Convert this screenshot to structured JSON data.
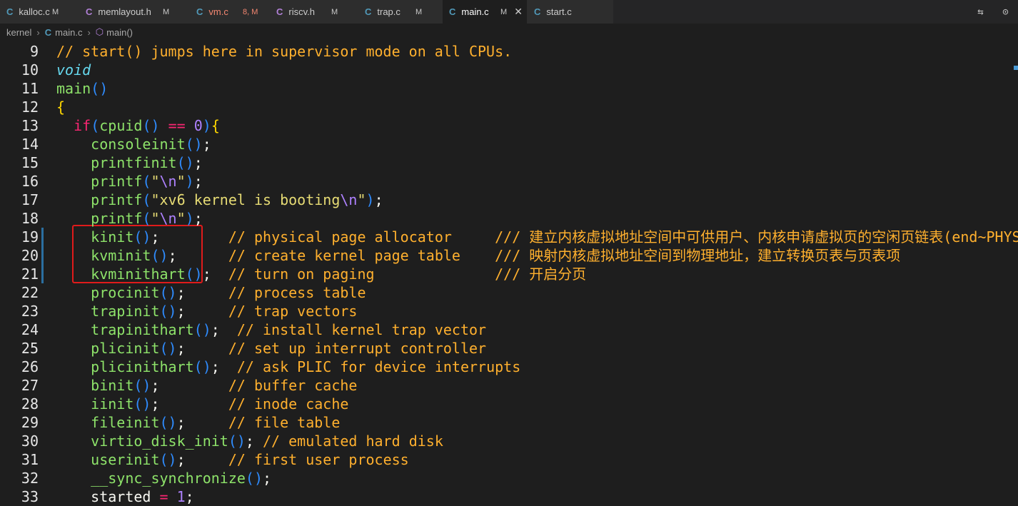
{
  "tabs": [
    {
      "icon": "C",
      "icon_color": "#519aba",
      "name": "kalloc.c",
      "status": "M",
      "status_color": "#c8c8c8",
      "name_color": "#cccccc"
    },
    {
      "icon": "C",
      "icon_color": "#b180d7",
      "name": "memlayout.h",
      "status": "M",
      "status_color": "#c8c8c8",
      "name_color": "#cccccc"
    },
    {
      "icon": "C",
      "icon_color": "#519aba",
      "name": "vm.c",
      "status": "8, M",
      "status_color": "#f48771",
      "name_color": "#f48771"
    },
    {
      "icon": "C",
      "icon_color": "#b180d7",
      "name": "riscv.h",
      "status": "M",
      "status_color": "#c8c8c8",
      "name_color": "#cccccc"
    },
    {
      "icon": "C",
      "icon_color": "#519aba",
      "name": "trap.c",
      "status": "M",
      "status_color": "#c8c8c8",
      "name_color": "#cccccc"
    },
    {
      "icon": "C",
      "icon_color": "#519aba",
      "name": "main.c",
      "status": "M",
      "status_color": "#c8c8c8",
      "name_color": "#ffffff",
      "active": true
    },
    {
      "icon": "C",
      "icon_color": "#519aba",
      "name": "start.c",
      "status": "",
      "status_color": "#c8c8c8",
      "name_color": "#cccccc"
    }
  ],
  "tab_close_glyph": "✕",
  "breadcrumb": {
    "folder": "kernel",
    "file": "main.c",
    "symbol": "main()"
  },
  "gutter": {
    "line_numbers": [
      "9",
      "10",
      "11",
      "12",
      "13",
      "14",
      "15",
      "16",
      "17",
      "18",
      "19",
      "20",
      "21",
      "22",
      "23",
      "24",
      "25",
      "26",
      "27",
      "28",
      "29",
      "30",
      "31",
      "32",
      "33"
    ]
  },
  "code_lines": [
    [
      [
        "cmt",
        "// start() jumps here in supervisor mode on all CPUs."
      ]
    ],
    [
      [
        "kw-type",
        "void"
      ]
    ],
    [
      [
        "fn",
        "main"
      ],
      [
        "paren",
        "()"
      ]
    ],
    [
      [
        "brace",
        "{"
      ]
    ],
    [
      [
        "plain",
        "  "
      ],
      [
        "kw",
        "if"
      ],
      [
        "paren",
        "("
      ],
      [
        "fn",
        "cpuid"
      ],
      [
        "paren",
        "()"
      ],
      [
        "plain",
        " "
      ],
      [
        "kw",
        "=="
      ],
      [
        "plain",
        " "
      ],
      [
        "num",
        "0"
      ],
      [
        "paren",
        ")"
      ],
      [
        "brace",
        "{"
      ]
    ],
    [
      [
        "plain",
        "    "
      ],
      [
        "fn",
        "consoleinit"
      ],
      [
        "paren",
        "()"
      ],
      [
        "plain",
        ";"
      ]
    ],
    [
      [
        "plain",
        "    "
      ],
      [
        "fn",
        "printfinit"
      ],
      [
        "paren",
        "()"
      ],
      [
        "plain",
        ";"
      ]
    ],
    [
      [
        "plain",
        "    "
      ],
      [
        "fn",
        "printf"
      ],
      [
        "paren",
        "("
      ],
      [
        "str",
        "\""
      ],
      [
        "esc",
        "\\n"
      ],
      [
        "str",
        "\""
      ],
      [
        "paren",
        ")"
      ],
      [
        "plain",
        ";"
      ]
    ],
    [
      [
        "plain",
        "    "
      ],
      [
        "fn",
        "printf"
      ],
      [
        "paren",
        "("
      ],
      [
        "str",
        "\"xv6 kernel is booting"
      ],
      [
        "esc",
        "\\n"
      ],
      [
        "str",
        "\""
      ],
      [
        "paren",
        ")"
      ],
      [
        "plain",
        ";"
      ]
    ],
    [
      [
        "plain",
        "    "
      ],
      [
        "fn",
        "printf"
      ],
      [
        "paren",
        "("
      ],
      [
        "str",
        "\""
      ],
      [
        "esc",
        "\\n"
      ],
      [
        "str",
        "\""
      ],
      [
        "paren",
        ")"
      ],
      [
        "plain",
        ";"
      ]
    ],
    [
      [
        "plain",
        "    "
      ],
      [
        "fn",
        "kinit"
      ],
      [
        "paren",
        "()"
      ],
      [
        "plain",
        ";        "
      ],
      [
        "cmt",
        "// physical page allocator     /// 建立内核虚拟地址空间中可供用户、内核申请虚拟页的空闲页链表(end~PHYSTOP)"
      ]
    ],
    [
      [
        "plain",
        "    "
      ],
      [
        "fn",
        "kvminit"
      ],
      [
        "paren",
        "()"
      ],
      [
        "plain",
        ";      "
      ],
      [
        "cmt",
        "// create kernel page table    /// 映射内核虚拟地址空间到物理地址，建立转换页表与页表项"
      ]
    ],
    [
      [
        "plain",
        "    "
      ],
      [
        "fn",
        "kvminithart"
      ],
      [
        "paren",
        "()"
      ],
      [
        "plain",
        ";  "
      ],
      [
        "cmt",
        "// turn on paging              /// 开启分页"
      ]
    ],
    [
      [
        "plain",
        "    "
      ],
      [
        "fn",
        "procinit"
      ],
      [
        "paren",
        "()"
      ],
      [
        "plain",
        ";     "
      ],
      [
        "cmt",
        "// process table"
      ]
    ],
    [
      [
        "plain",
        "    "
      ],
      [
        "fn",
        "trapinit"
      ],
      [
        "paren",
        "()"
      ],
      [
        "plain",
        ";     "
      ],
      [
        "cmt",
        "// trap vectors"
      ]
    ],
    [
      [
        "plain",
        "    "
      ],
      [
        "fn",
        "trapinithart"
      ],
      [
        "paren",
        "()"
      ],
      [
        "plain",
        ";  "
      ],
      [
        "cmt",
        "// install kernel trap vector"
      ]
    ],
    [
      [
        "plain",
        "    "
      ],
      [
        "fn",
        "plicinit"
      ],
      [
        "paren",
        "()"
      ],
      [
        "plain",
        ";     "
      ],
      [
        "cmt",
        "// set up interrupt controller"
      ]
    ],
    [
      [
        "plain",
        "    "
      ],
      [
        "fn",
        "plicinithart"
      ],
      [
        "paren",
        "()"
      ],
      [
        "plain",
        ";  "
      ],
      [
        "cmt",
        "// ask PLIC for device interrupts"
      ]
    ],
    [
      [
        "plain",
        "    "
      ],
      [
        "fn",
        "binit"
      ],
      [
        "paren",
        "()"
      ],
      [
        "plain",
        ";        "
      ],
      [
        "cmt",
        "// buffer cache"
      ]
    ],
    [
      [
        "plain",
        "    "
      ],
      [
        "fn",
        "iinit"
      ],
      [
        "paren",
        "()"
      ],
      [
        "plain",
        ";        "
      ],
      [
        "cmt",
        "// inode cache"
      ]
    ],
    [
      [
        "plain",
        "    "
      ],
      [
        "fn",
        "fileinit"
      ],
      [
        "paren",
        "()"
      ],
      [
        "plain",
        ";     "
      ],
      [
        "cmt",
        "// file table"
      ]
    ],
    [
      [
        "plain",
        "    "
      ],
      [
        "fn",
        "virtio_disk_init"
      ],
      [
        "paren",
        "()"
      ],
      [
        "plain",
        "; "
      ],
      [
        "cmt",
        "// emulated hard disk"
      ]
    ],
    [
      [
        "plain",
        "    "
      ],
      [
        "fn",
        "userinit"
      ],
      [
        "paren",
        "()"
      ],
      [
        "plain",
        ";     "
      ],
      [
        "cmt",
        "// first user process"
      ]
    ],
    [
      [
        "plain",
        "    "
      ],
      [
        "fn",
        "__sync_synchronize"
      ],
      [
        "paren",
        "()"
      ],
      [
        "plain",
        ";"
      ]
    ],
    [
      [
        "plain",
        "    started "
      ],
      [
        "kw",
        "="
      ],
      [
        "plain",
        " "
      ],
      [
        "num",
        "1"
      ],
      [
        "plain",
        ";"
      ]
    ]
  ],
  "modified_lines": [
    "19",
    "20",
    "21"
  ],
  "actions": {
    "compare_icon": "⇆",
    "timeline_icon": "⊙",
    "more_icon": "⋯"
  }
}
